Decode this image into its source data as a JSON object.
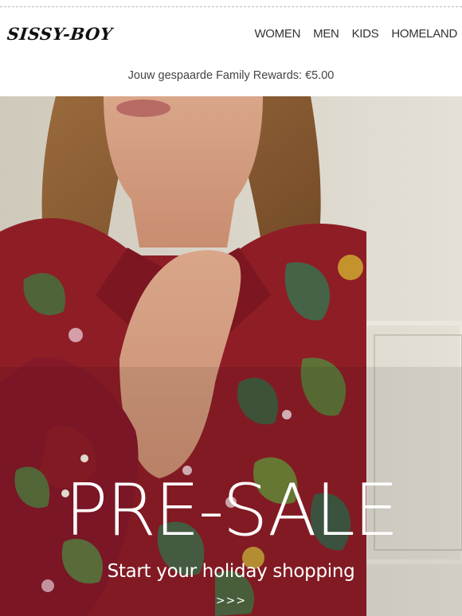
{
  "header": {
    "logo": "SISSY-BOY",
    "nav": [
      {
        "label": "WOMEN"
      },
      {
        "label": "MEN"
      },
      {
        "label": "KIDS"
      },
      {
        "label": "HOMELAND"
      }
    ]
  },
  "rewards_text": "Jouw gespaarde Family Rewards: €5.00",
  "hero": {
    "title": "PRE-SALE",
    "subtitle": "Start your holiday shopping",
    "cta": ">>>",
    "colors": {
      "background": "#d8d3c6",
      "shirt": "#8e1d26",
      "text": "#ffffff"
    }
  }
}
